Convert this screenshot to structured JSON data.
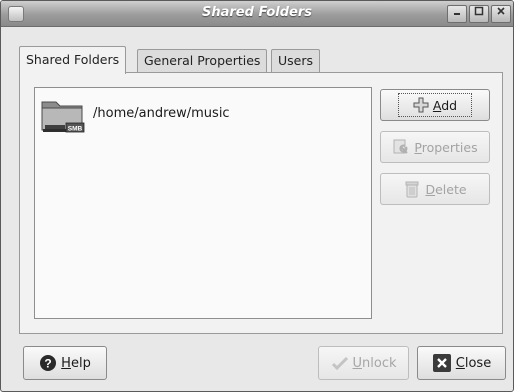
{
  "window": {
    "title": "Shared Folders"
  },
  "tabs": [
    {
      "label": "Shared Folders"
    },
    {
      "label": "General Properties"
    },
    {
      "label": "Users"
    }
  ],
  "shares": [
    {
      "path": "/home/andrew/music",
      "icon": "folder-smb-icon",
      "badge": "SMB"
    }
  ],
  "side_buttons": {
    "add": {
      "mnemonic": "A",
      "rest": "dd",
      "icon": "add-icon"
    },
    "properties": {
      "mnemonic": "P",
      "rest": "roperties",
      "icon": "properties-icon"
    },
    "delete": {
      "mnemonic": "D",
      "rest": "elete",
      "icon": "trash-icon"
    }
  },
  "bottom_buttons": {
    "help": {
      "mnemonic": "H",
      "rest": "elp",
      "icon": "help-icon"
    },
    "unlock": {
      "mnemonic": "U",
      "rest": "nlock",
      "icon": "unlock-icon"
    },
    "close": {
      "mnemonic": "C",
      "rest": "lose",
      "icon": "close-icon"
    }
  },
  "colors": {
    "disabled_text": "#a3a3a3",
    "titlebar": "#9c9c9c"
  }
}
